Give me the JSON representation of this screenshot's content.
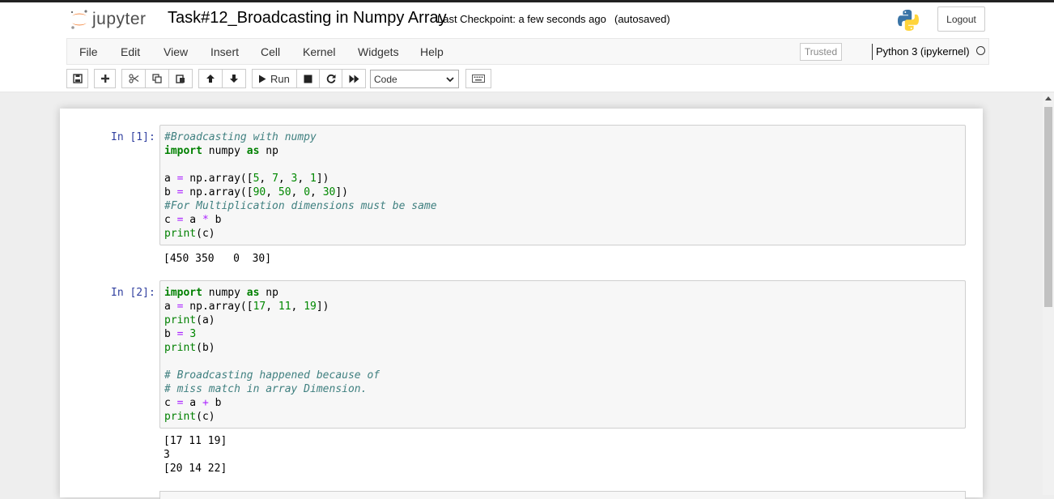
{
  "header": {
    "logo_text": "jupyter",
    "notebook_title": "Task#12_Broadcasting in Numpy Array",
    "checkpoint": "Last Checkpoint: a few seconds ago",
    "autosave_status": "(autosaved)",
    "logout_label": "Logout"
  },
  "menubar": {
    "items": [
      "File",
      "Edit",
      "View",
      "Insert",
      "Cell",
      "Kernel",
      "Widgets",
      "Help"
    ],
    "trusted_label": "Trusted",
    "kernel_name": "Python 3 (ipykernel)"
  },
  "toolbar": {
    "run_label": "Run",
    "cell_type": "Code",
    "icons": [
      "save-icon",
      "plus-icon",
      "cut-icon",
      "copy-icon",
      "paste-icon",
      "arrow-up-icon",
      "arrow-down-icon",
      "run-icon",
      "stop-icon",
      "restart-icon",
      "fast-forward-icon",
      "keyboard-icon"
    ]
  },
  "cells": [
    {
      "prompt": "In [1]:",
      "code": [
        "#Broadcasting with numpy",
        "import numpy as np",
        "",
        "a = np.array([5, 7, 3, 1])",
        "b = np.array([90, 50, 0, 30])",
        "#For Multiplication dimensions must be same",
        "c = a * b",
        "print(c)"
      ],
      "output": [
        "[450 350   0  30]"
      ]
    },
    {
      "prompt": "In [2]:",
      "code": [
        "import numpy as np",
        "a = np.array([17, 11, 19])",
        "print(a)",
        "b = 3",
        "print(b)",
        "",
        "# Broadcasting happened because of",
        "# miss match in array Dimension.",
        "c = a + b",
        "print(c)"
      ],
      "output": [
        "[17 11 19]",
        "3",
        "[20 14 22]"
      ]
    }
  ],
  "colors": {
    "prompt": "#303f9f",
    "comment": "#408080",
    "keyword": "#008000",
    "number": "#008800",
    "operator": "#aa22ff",
    "logo_orange": "#f37726"
  }
}
